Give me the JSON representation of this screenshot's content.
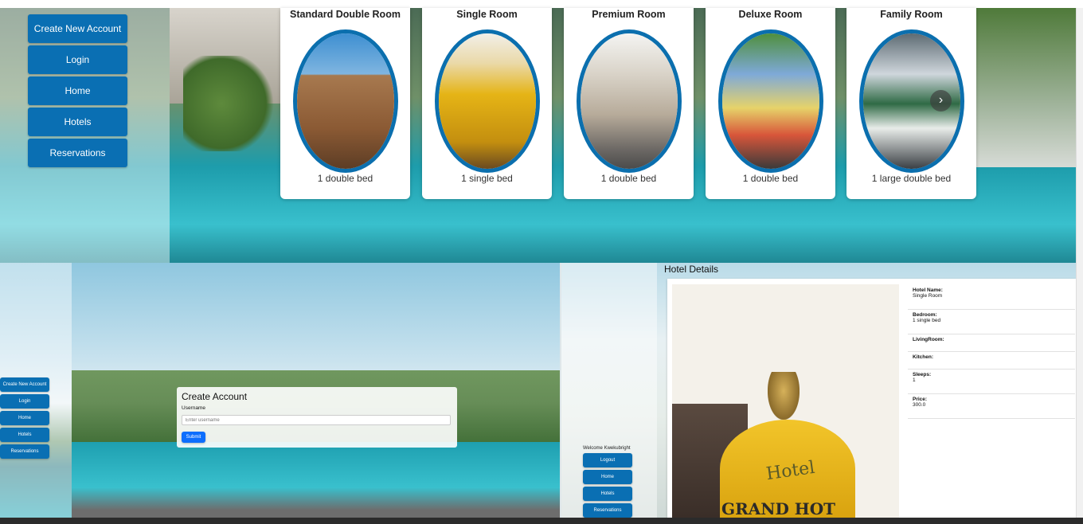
{
  "top_nav": {
    "items": [
      "Create New Account",
      "Login",
      "Home",
      "Hotels",
      "Reservations"
    ]
  },
  "rooms": [
    {
      "name": "Standard Double Room",
      "bed": "1 double bed",
      "palette": "#8b5a34"
    },
    {
      "name": "Single Room",
      "bed": "1 single bed",
      "palette": "#e5b416"
    },
    {
      "name": "Premium Room",
      "bed": "1 double bed",
      "palette": "#c9c1b5"
    },
    {
      "name": "Deluxe Room",
      "bed": "1 double bed",
      "palette": "#7ea9d8"
    },
    {
      "name": "Family Room",
      "bed": "1 large double bed",
      "palette": "#cfd6dc"
    }
  ],
  "carousel_next_icon": "chevron-right-icon",
  "create_account": {
    "side_nav": [
      "Create New Account",
      "Login",
      "Home",
      "Hotels",
      "Reservations"
    ],
    "title": "Create Account",
    "username_label": "Username",
    "username_placeholder": "Enter username",
    "submit_label": "Submit"
  },
  "hotel_details": {
    "heading": "Hotel Details",
    "welcome": "Welcome Kwekubright",
    "side_nav": [
      "Logout",
      "Home",
      "Hotels",
      "Reservations"
    ],
    "image_sign": "Hotel",
    "image_sign_bottom": "GRAND HOT",
    "fields": [
      {
        "label": "Hotel Name:",
        "value": "Single Room"
      },
      {
        "label": "Bedroom:",
        "value": "1 single bed"
      },
      {
        "label": "LivingRoom:",
        "value": ""
      },
      {
        "label": "Kitchen:",
        "value": ""
      },
      {
        "label": "Sleeps:",
        "value": "1"
      },
      {
        "label": "Price:",
        "value": "300.0"
      }
    ]
  },
  "colors": {
    "primary": "#0a6fb3",
    "oval_border": "#0b6fae",
    "submit": "#0d6efd"
  }
}
